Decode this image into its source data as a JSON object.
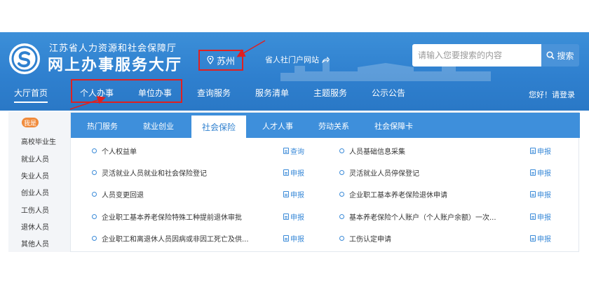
{
  "header": {
    "brand_sub": "江苏省人力资源和社会保障厅",
    "brand_main": "网上办事服务大厅",
    "city": "苏州",
    "portal_link": "省人社门户网站",
    "search_placeholder": "请输入您要搜索的内容",
    "search_button": "搜索",
    "login_text": "您好！请登录"
  },
  "nav": {
    "items": [
      "大厅首页",
      "个人办事",
      "单位办事",
      "查询服务",
      "服务清单",
      "主题服务",
      "公示公告"
    ]
  },
  "sidebar": {
    "badge": "我是",
    "items": [
      "高校毕业生",
      "就业人员",
      "失业人员",
      "创业人员",
      "工伤人员",
      "退休人员",
      "其他人员"
    ]
  },
  "tabs": [
    "热门服务",
    "就业创业",
    "社会保险",
    "人才人事",
    "劳动关系",
    "社会保障卡"
  ],
  "services_left": [
    {
      "name": "个人权益单",
      "action": "查询"
    },
    {
      "name": "灵活就业人员就业和社会保险登记",
      "action": "申报"
    },
    {
      "name": "人员变更回退",
      "action": "申报"
    },
    {
      "name": "企业职工基本养老保险特殊工种提前退休审批",
      "action": "申报"
    },
    {
      "name": "企业职工和离退休人员因病或非因工死亡及供...",
      "action": "申报"
    }
  ],
  "services_right": [
    {
      "name": "人员基础信息采集",
      "action": "申报"
    },
    {
      "name": "灵活就业人员停保登记",
      "action": "申报"
    },
    {
      "name": "企业职工基本养老保险退休申请",
      "action": "申报"
    },
    {
      "name": "基本养老保险个人账户（个人账户余额）一次...",
      "action": "申报"
    },
    {
      "name": "工伤认定申请",
      "action": "申报"
    }
  ],
  "colors": {
    "header_blue": "#2f80cf",
    "tab_blue": "#3e8fdb",
    "highlight_red": "#e02020",
    "badge_orange": "#f08a3a"
  }
}
